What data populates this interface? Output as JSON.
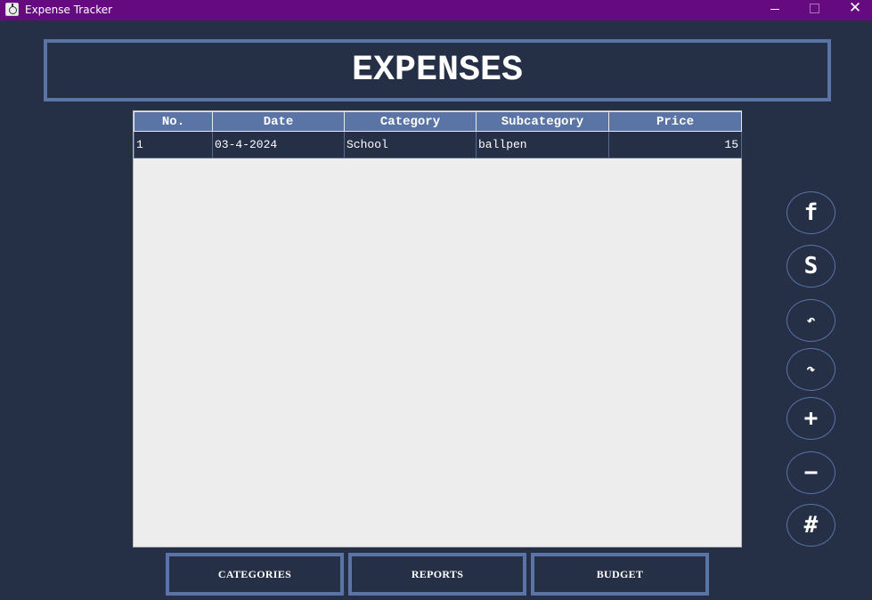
{
  "window": {
    "title": "Expense Tracker",
    "minimize_glyph": "",
    "close_glyph": "✕"
  },
  "header": {
    "title": "EXPENSES"
  },
  "table": {
    "columns": [
      "No.",
      "Date",
      "Category",
      "Subcategory",
      "Price"
    ],
    "rows": [
      {
        "no": "1",
        "date": "03-4-2024",
        "category": "School",
        "subcategory": "ballpen",
        "price": "15"
      }
    ]
  },
  "side_buttons": [
    {
      "label": "f",
      "icon": "file-icon"
    },
    {
      "label": "S",
      "icon": "save-icon"
    },
    {
      "label": "↶",
      "icon": "undo-icon"
    },
    {
      "label": "↷",
      "icon": "redo-icon"
    },
    {
      "label": "+",
      "icon": "add-icon"
    },
    {
      "label": "−",
      "icon": "remove-icon"
    },
    {
      "label": "#",
      "icon": "hash-icon"
    }
  ],
  "bottom_buttons": {
    "categories": "CATEGORIES",
    "reports": "REPORTS",
    "budget": "BUDGET"
  },
  "colors": {
    "titlebar": "#660a80",
    "background": "#253047",
    "accent": "#5a74a6",
    "table_body": "#ededed"
  }
}
